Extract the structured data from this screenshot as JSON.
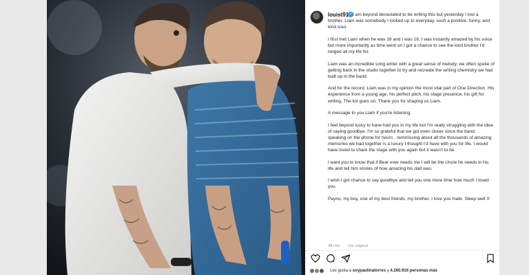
{
  "post": {
    "username": "louist91",
    "verified_mark": "✓",
    "caption": [
      "I am beyond devastated to be writing this but yesterday I lost a brother. Liam was somebody I looked up to everyday, such a positive, funny, and kind soul.",
      "I first met Liam when he was 16 and I was 18. I was instantly amazed by his voice but more importantly as time went on I got a chance to see the kind brother I'd longed all my life for.",
      "Liam was an incredible song writer with a great sense of melody, we often spoke of getting back in the studio together to try and recreate the writing chemistry we had built up in the band.",
      "And for the record, Liam was in my opinion the most vital part of One Direction. His experience from a young age, his perfect pitch, his stage presence, his gift for writing. The list goes on. Thank you for shaping us Liam.",
      "A message to you Liam if you're listening.",
      "I feel beyond lucky to have had you in my life but I'm really struggling with the idea of saying goodbye. I'm so grateful that we got even closer since the band, speaking on the phone for hours , reminiscing about all the thousands of amazing memories we had together is a luxury I thought I'd have with you for life. I would have loved to share the stage with you again but it wasn't to be.",
      "I want you to know that if Bear ever needs me I will be the Uncle he needs in his life and tell him stories of how amazing his dad was.",
      "I wish I got chance to say goodbye and tell you one more time how much I loved you.",
      "Payno, my boy, one of my best friends, my brother, I love you mate. Sleep well X"
    ],
    "time_ago": "38 min",
    "see_translation": "Ver original",
    "likes_prefix": "Les gusta a",
    "likes_user": "soypaulinatorres",
    "likes_connector": "y",
    "likes_count": "4.260.916",
    "likes_suffix": "personas más",
    "icons": {
      "like": "heart-icon",
      "comment": "comment-icon",
      "share": "share-icon",
      "save": "bookmark-icon"
    },
    "colors": {
      "verified": "#3897f0",
      "text": "#262626",
      "muted": "#8e8e8e"
    }
  }
}
